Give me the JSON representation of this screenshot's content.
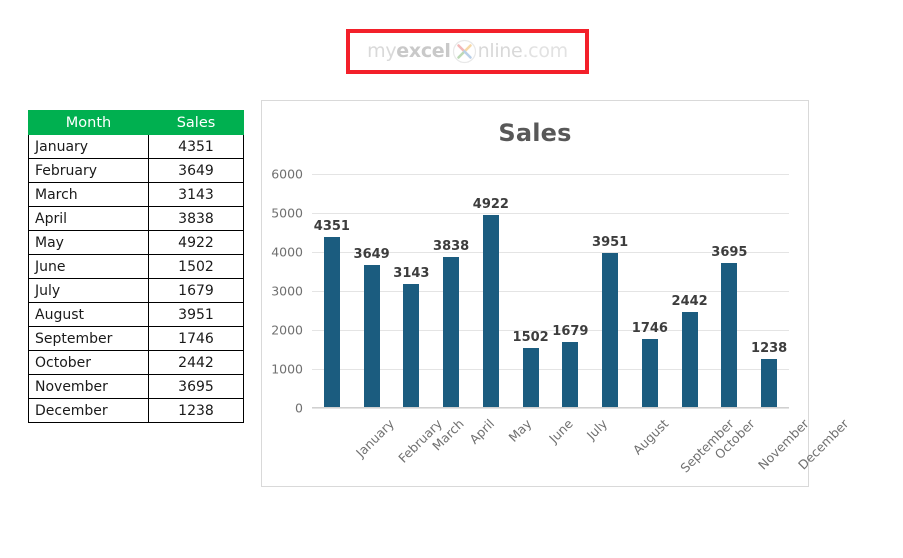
{
  "logo": {
    "part_my": "my",
    "part_excel": "excel",
    "part_nline": "nline",
    "part_com": ".com",
    "icon": "x-cross-circle-icon",
    "border_color": "#f3202a"
  },
  "table": {
    "headers": [
      "Month",
      "Sales"
    ],
    "header_bg": "#00b050",
    "rows": [
      {
        "month": "January",
        "sales": "4351"
      },
      {
        "month": "February",
        "sales": "3649"
      },
      {
        "month": "March",
        "sales": "3143"
      },
      {
        "month": "April",
        "sales": "3838"
      },
      {
        "month": "May",
        "sales": "4922"
      },
      {
        "month": "June",
        "sales": "1502"
      },
      {
        "month": "July",
        "sales": "1679"
      },
      {
        "month": "August",
        "sales": "3951"
      },
      {
        "month": "September",
        "sales": "1746"
      },
      {
        "month": "October",
        "sales": "2442"
      },
      {
        "month": "November",
        "sales": "3695"
      },
      {
        "month": "December",
        "sales": "1238"
      }
    ]
  },
  "chart_data": {
    "type": "bar",
    "title": "Sales",
    "xlabel": "",
    "ylabel": "",
    "categories": [
      "January",
      "February",
      "March",
      "April",
      "May",
      "June",
      "July",
      "August",
      "September",
      "October",
      "November",
      "December"
    ],
    "values": [
      4351,
      3649,
      3143,
      3838,
      4922,
      1502,
      1679,
      3951,
      1746,
      2442,
      3695,
      1238
    ],
    "data_labels": [
      "4351",
      "3649",
      "3143",
      "3838",
      "4922",
      "1502",
      "1679",
      "3951",
      "1746",
      "2442",
      "3695",
      "1238"
    ],
    "ylim": [
      0,
      6000
    ],
    "yticks": [
      0,
      1000,
      2000,
      3000,
      4000,
      5000,
      6000
    ],
    "ytick_labels": [
      "0",
      "1000",
      "2000",
      "3000",
      "4000",
      "5000",
      "6000"
    ],
    "grid": true,
    "legend": false,
    "bar_color": "#1b5c7f",
    "title_color": "#585858",
    "xtick_rotation": -45
  }
}
